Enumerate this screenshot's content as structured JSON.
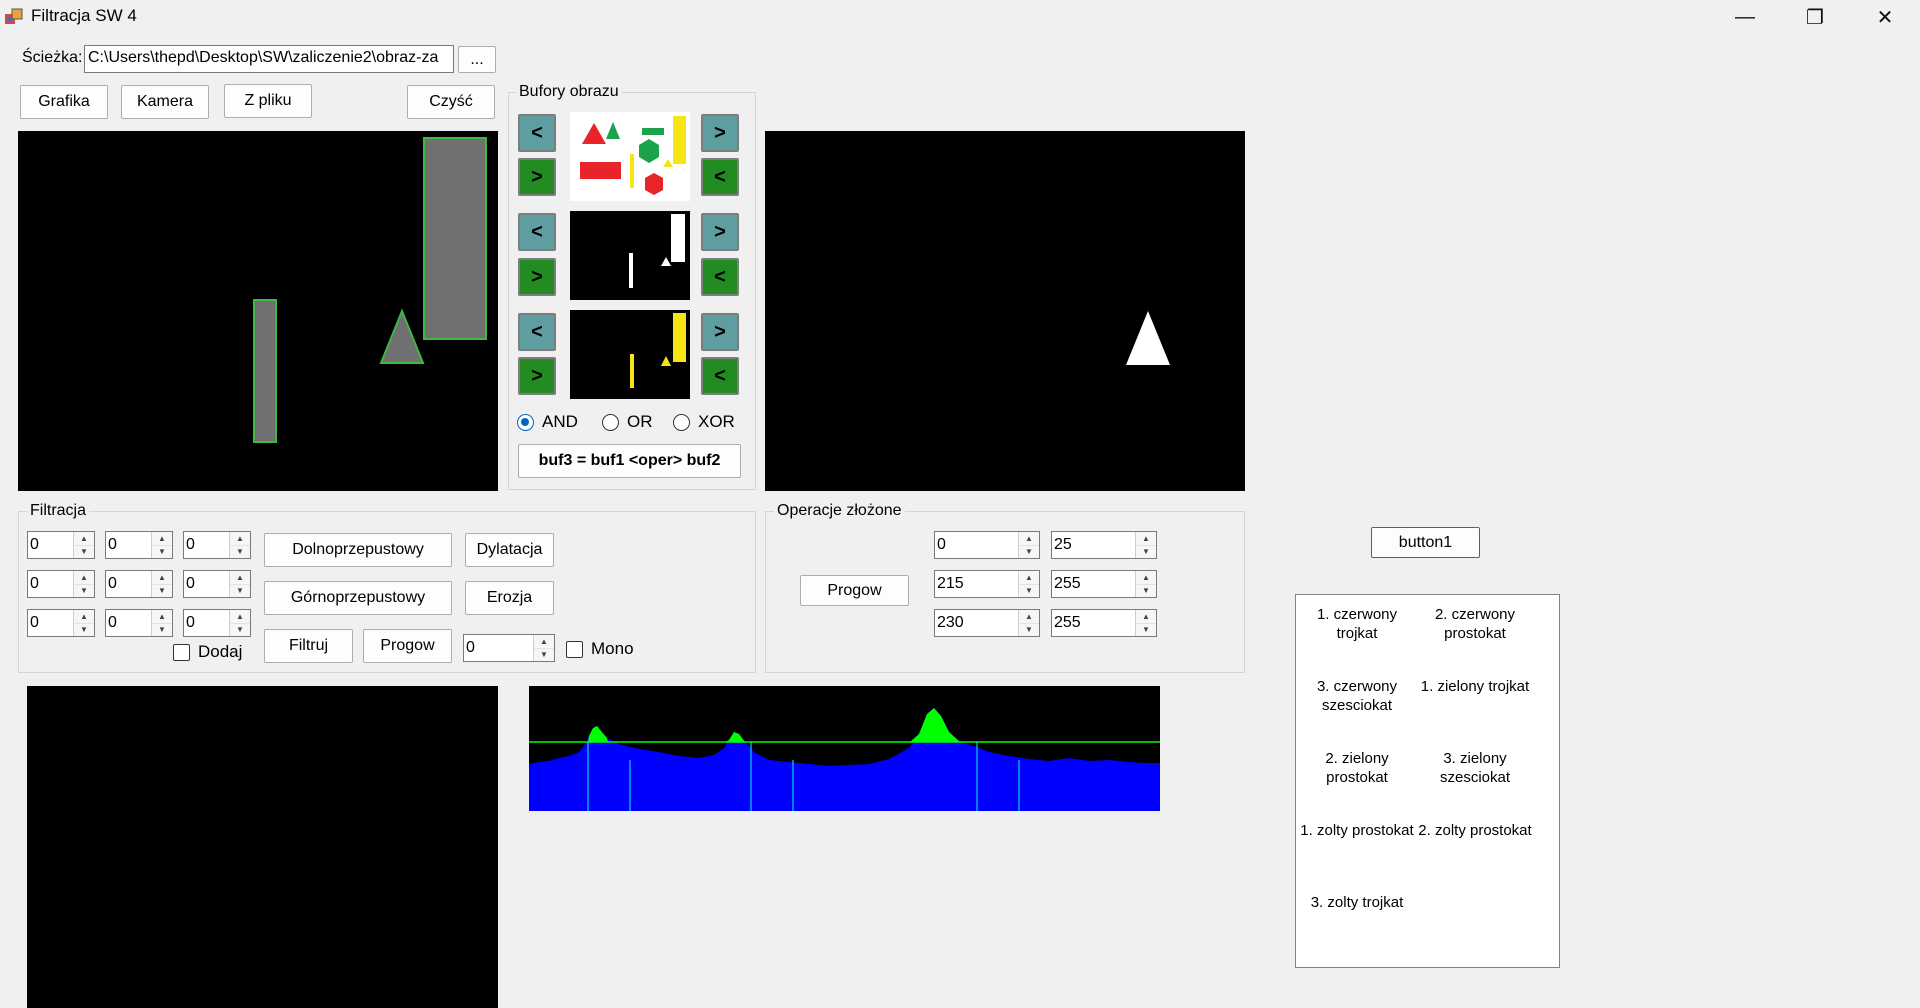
{
  "window": {
    "title": "Filtracja SW 4",
    "minimize": "—",
    "restore": "❐",
    "close": "✕"
  },
  "path": {
    "label": "Ścieżka:",
    "value": "C:\\Users\\thepd\\Desktop\\SW\\zaliczenie2\\obraz-za",
    "browse": "..."
  },
  "source_buttons": {
    "grafika": "Grafika",
    "kamera": "Kamera",
    "zpliku": "Z pliku",
    "czysc": "Czyść"
  },
  "buffers": {
    "group": "Bufory obrazu",
    "left_arrow": "<",
    "right_arrow": ">",
    "ops": [
      "AND",
      "OR",
      "XOR"
    ],
    "selected_op": "AND",
    "formula": "buf3 = buf1 <oper> buf2"
  },
  "filtering": {
    "group": "Filtracja",
    "kernel": [
      [
        "0",
        "0",
        "0"
      ],
      [
        "0",
        "0",
        "0"
      ],
      [
        "0",
        "0",
        "0"
      ]
    ],
    "dodaj": "Dodaj",
    "lowpass": "Dolnoprzepustowy",
    "highpass": "Górnoprzepustowy",
    "dilation": "Dylatacja",
    "erosion": "Erozja",
    "filter": "Filtruj",
    "threshold_btn": "Progow",
    "threshold_val": "0",
    "mono": "Mono"
  },
  "complex_ops": {
    "group": "Operacje złożone",
    "threshold_btn": "Progow",
    "ranges": [
      [
        "0",
        "25"
      ],
      [
        "215",
        "255"
      ],
      [
        "230",
        "255"
      ]
    ]
  },
  "button1": "button1",
  "results": [
    "1. czerwony trojkat",
    "2. czerwony prostokat",
    "3. czerwony szesciokat",
    "1. zielony trojkat",
    "2. zielony prostokat",
    "3. zielony szesciokat",
    "1. zolty prostokat",
    "2. zolty prostokat",
    "3. zolty trojkat"
  ],
  "colors": {
    "teal": "#5f9ea0",
    "green": "#228b22",
    "hist_blue": "#0000ff",
    "hist_green": "#00ff00",
    "accent": "#0078d7"
  }
}
